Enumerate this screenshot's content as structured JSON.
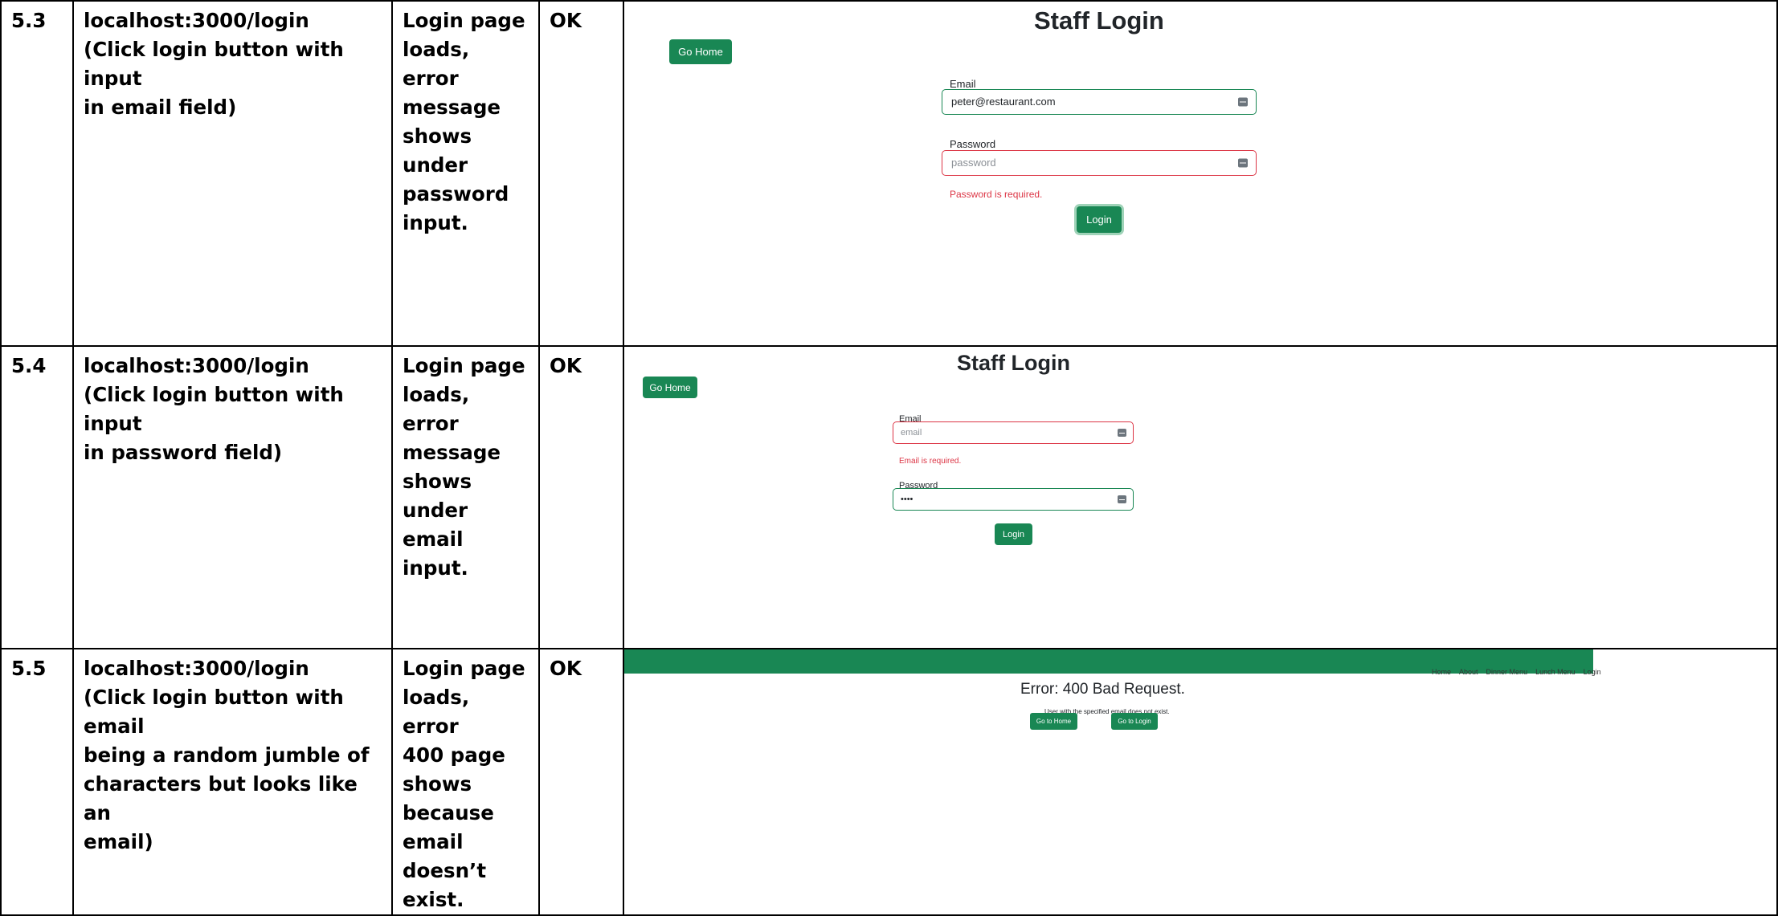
{
  "rows": [
    {
      "id": "5.3",
      "description": [
        "localhost:3000/login",
        "(Click login button with input",
        "in email field)"
      ],
      "expected": [
        "Login page",
        "loads, error",
        "message",
        "shows",
        "under",
        "password",
        "input."
      ],
      "result": "OK",
      "screenshot": {
        "title": "Staff Login",
        "home_button": "Go Home",
        "email_label": "Email",
        "email_value": "peter@restaurant.com",
        "password_label": "Password",
        "password_placeholder": "password",
        "error_text": "Password is required.",
        "login_button": "Login"
      }
    },
    {
      "id": "5.4",
      "description": [
        "localhost:3000/login",
        "(Click login button with input",
        "in password field)"
      ],
      "expected": [
        "Login page",
        "loads, error",
        "message",
        "shows",
        "under email",
        "input."
      ],
      "result": "OK",
      "screenshot": {
        "title": "Staff Login",
        "home_button": "Go Home",
        "email_label": "Email",
        "email_placeholder": "email",
        "error_text": "Email is required.",
        "password_label": "Password",
        "password_value": "••••",
        "login_button": "Login"
      }
    },
    {
      "id": "5.5",
      "description": [
        "localhost:3000/login",
        "(Click login button with email",
        "being a random jumble of",
        "characters but looks like an",
        "email)"
      ],
      "expected": [
        "Login page",
        "loads, error",
        "400 page",
        "shows",
        "because",
        "email",
        "doesn’t",
        "exist."
      ],
      "result": "OK",
      "screenshot": {
        "nav_links": [
          "Home",
          "About",
          "Dinner Menu",
          "Lunch Menu",
          "Login"
        ],
        "error_title": "Error: 400 Bad Request.",
        "error_message": "User with the specified email does not exist.",
        "home_button": "Go to Home",
        "login_button": "Go to Login"
      }
    }
  ],
  "colors": {
    "accent": "#198754",
    "error": "#dc3545"
  }
}
